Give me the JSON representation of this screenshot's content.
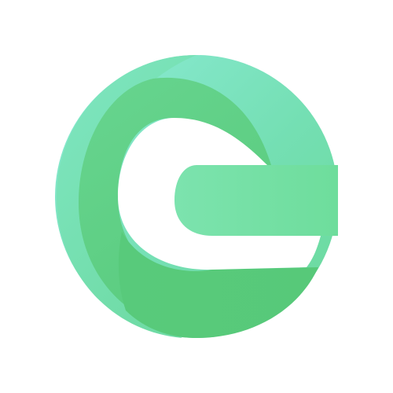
{
  "logo": {
    "icon": "letter-e-swirl-logo-icon",
    "colors": {
      "background": "#ffffff",
      "light_mint": "#8CEBD6",
      "mid_green": "#6DDA9A",
      "deep_green": "#55C977",
      "highlight_green": "#7BE3A5"
    }
  }
}
